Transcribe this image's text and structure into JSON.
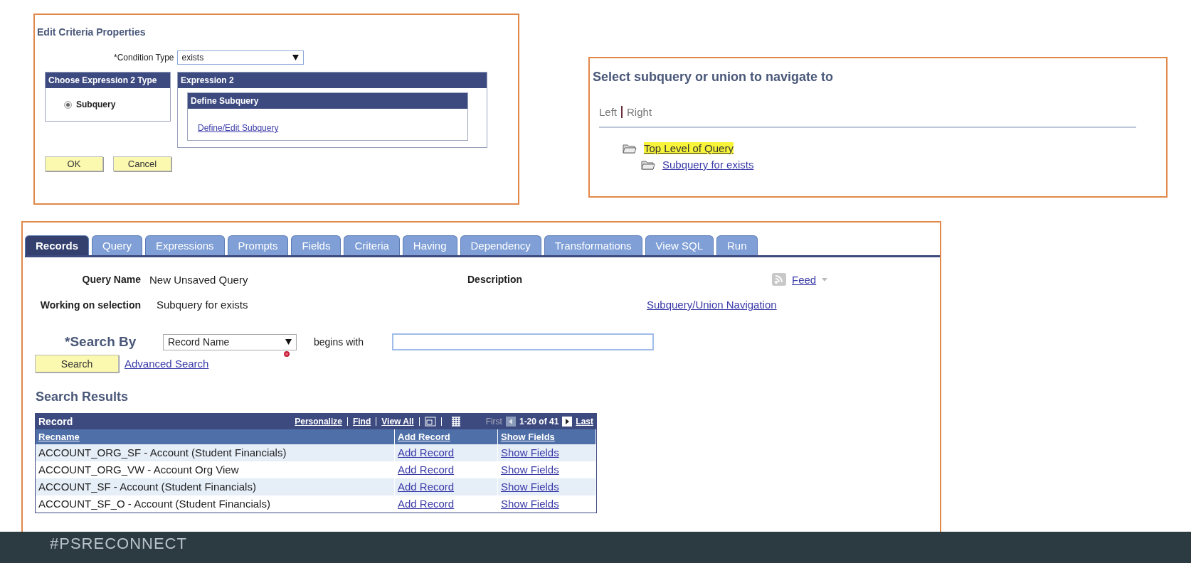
{
  "criteria_dialog": {
    "title": "Edit Criteria Properties",
    "condition_label": "*Condition Type",
    "condition_value": "exists",
    "expr_type": {
      "header": "Choose Expression 2 Type",
      "options": [
        {
          "label": "Subquery",
          "selected": true
        }
      ]
    },
    "expr2": {
      "header": "Expression 2",
      "sub_header": "Define Subquery",
      "link": "Define/Edit Subquery"
    },
    "buttons": [
      "OK",
      "Cancel"
    ]
  },
  "navigator": {
    "title": "Select subquery or union to navigate to",
    "sides": [
      "Left",
      "Right"
    ],
    "tree": [
      {
        "label": "Top Level of Query",
        "selected": true,
        "children": [
          {
            "label": "Subquery for exists",
            "selected": false
          }
        ]
      }
    ]
  },
  "query_page": {
    "tabs": [
      {
        "label": "Records",
        "selected": true
      },
      {
        "label": "Query",
        "selected": false
      },
      {
        "label": "Expressions",
        "selected": false
      },
      {
        "label": "Prompts",
        "selected": false
      },
      {
        "label": "Fields",
        "selected": false
      },
      {
        "label": "Criteria",
        "selected": false
      },
      {
        "label": "Having",
        "selected": false
      },
      {
        "label": "Dependency",
        "selected": false
      },
      {
        "label": "Transformations",
        "selected": false
      },
      {
        "label": "View SQL",
        "selected": false
      },
      {
        "label": "Run",
        "selected": false
      }
    ],
    "query_name_label": "Query Name",
    "query_name": "New Unsaved Query",
    "description_label": "Description",
    "feed": "Feed",
    "selection_label": "Working on selection",
    "selection": "Subquery for exists",
    "union_nav": "Subquery/Union Navigation",
    "search_by_label": "*Search By",
    "search_by": "Record Name",
    "begins_with": "begins with",
    "search_button": "Search",
    "advanced_search": "Advanced Search",
    "results_title": "Search Results",
    "grid": {
      "title": "Record",
      "nav": [
        "Personalize",
        "Find",
        "View All"
      ],
      "first": "First",
      "range": "1-20 of 41",
      "last": "Last",
      "columns": [
        "Recname",
        "Add Record",
        "Show Fields"
      ],
      "rows": [
        [
          "ACCOUNT_ORG_SF - Account (Student Financials)",
          "Add Record",
          "Show Fields"
        ],
        [
          "ACCOUNT_ORG_VW - Account Org View",
          "Add Record",
          "Show Fields"
        ],
        [
          "ACCOUNT_SF - Account (Student Financials)",
          "Add Record",
          "Show Fields"
        ],
        [
          "ACCOUNT_SF_O - Account (Student Financials)",
          "Add Record",
          "Show Fields"
        ]
      ]
    }
  },
  "footer": {
    "hashtag": "#PSRECONNECT"
  }
}
